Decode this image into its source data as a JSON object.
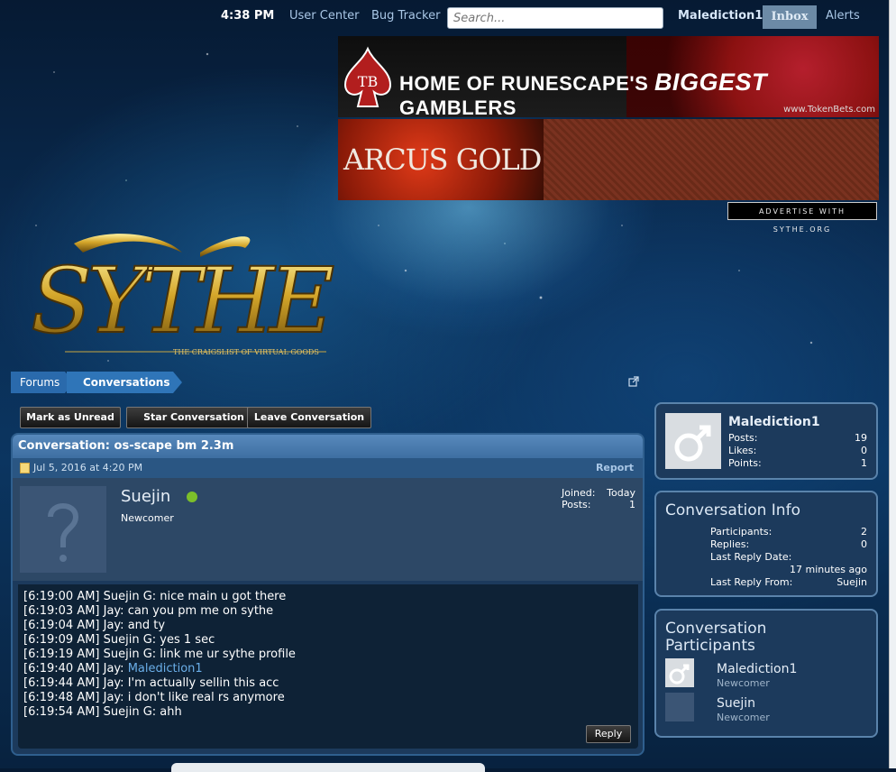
{
  "topbar": {
    "time": "4:38 PM",
    "user_center": "User Center",
    "bug_tracker": "Bug Tracker",
    "search_placeholder": "Search...",
    "username": "Malediction1",
    "inbox": "Inbox",
    "alerts": "Alerts"
  },
  "ads": {
    "banner1_prefix": "HOME OF RUNESCAPE'S ",
    "banner1_big": "BIGGEST",
    "banner1_suffix": " GAMBLERS",
    "banner1_url": "www.TokenBets.com",
    "banner2_text": "ARCUS GOLD",
    "advertise": "ADVERTISE WITH SYTHE.ORG"
  },
  "logo": {
    "name": "SYTHE",
    "tagline": "THE CRAIGSLIST OF VIRTUAL GOODS"
  },
  "breadcrumb": {
    "forums": "Forums",
    "conversations": "Conversations"
  },
  "actions": {
    "mark_unread": "Mark as Unread",
    "star": "Star Conversation",
    "leave": "Leave Conversation"
  },
  "conversation": {
    "title": "Conversation: os-scape bm 2.3m",
    "date": "Jul 5, 2016 at 4:20 PM",
    "report": "Report",
    "author": "Suejin",
    "author_title": "Newcomer",
    "joined_label": "Joined:",
    "joined_value": "Today",
    "posts_label": "Posts:",
    "posts_value": "1",
    "messages": [
      "[6:19:00 AM] Suejin G: nice main u got there",
      "[6:19:03 AM] Jay: can you pm me on sythe",
      "[6:19:04 AM] Jay: and ty",
      "[6:19:09 AM] Suejin G: yes 1 sec",
      "[6:19:19 AM] Suejin G: link me ur sythe profile",
      "[6:19:40 AM] Jay: ",
      "[6:19:44 AM] Jay: I'm actually sellin this acc",
      "[6:19:48 AM] Jay: i don't like real rs anymore",
      "[6:19:54 AM] Suejin G: ahh"
    ],
    "message_link": "Malediction1",
    "reply": "Reply"
  },
  "sidebar": {
    "user": {
      "name": "Malediction1",
      "posts_label": "Posts:",
      "posts": "19",
      "likes_label": "Likes:",
      "likes": "0",
      "points_label": "Points:",
      "points": "1"
    },
    "info": {
      "heading": "Conversation Info",
      "participants_label": "Participants:",
      "participants": "2",
      "replies_label": "Replies:",
      "replies": "0",
      "last_reply_date_label": "Last Reply Date:",
      "last_reply_date": "17 minutes ago",
      "last_reply_from_label": "Last Reply From:",
      "last_reply_from": "Suejin"
    },
    "participants": {
      "heading_line1": "Conversation",
      "heading_line2": "Participants",
      "list": [
        {
          "name": "Malediction1",
          "role": "Newcomer"
        },
        {
          "name": "Suejin",
          "role": "Newcomer"
        }
      ]
    }
  },
  "colors": {
    "accent": "#2f75b8",
    "online": "#7cbf2a",
    "panel": "#1c3a5c"
  }
}
